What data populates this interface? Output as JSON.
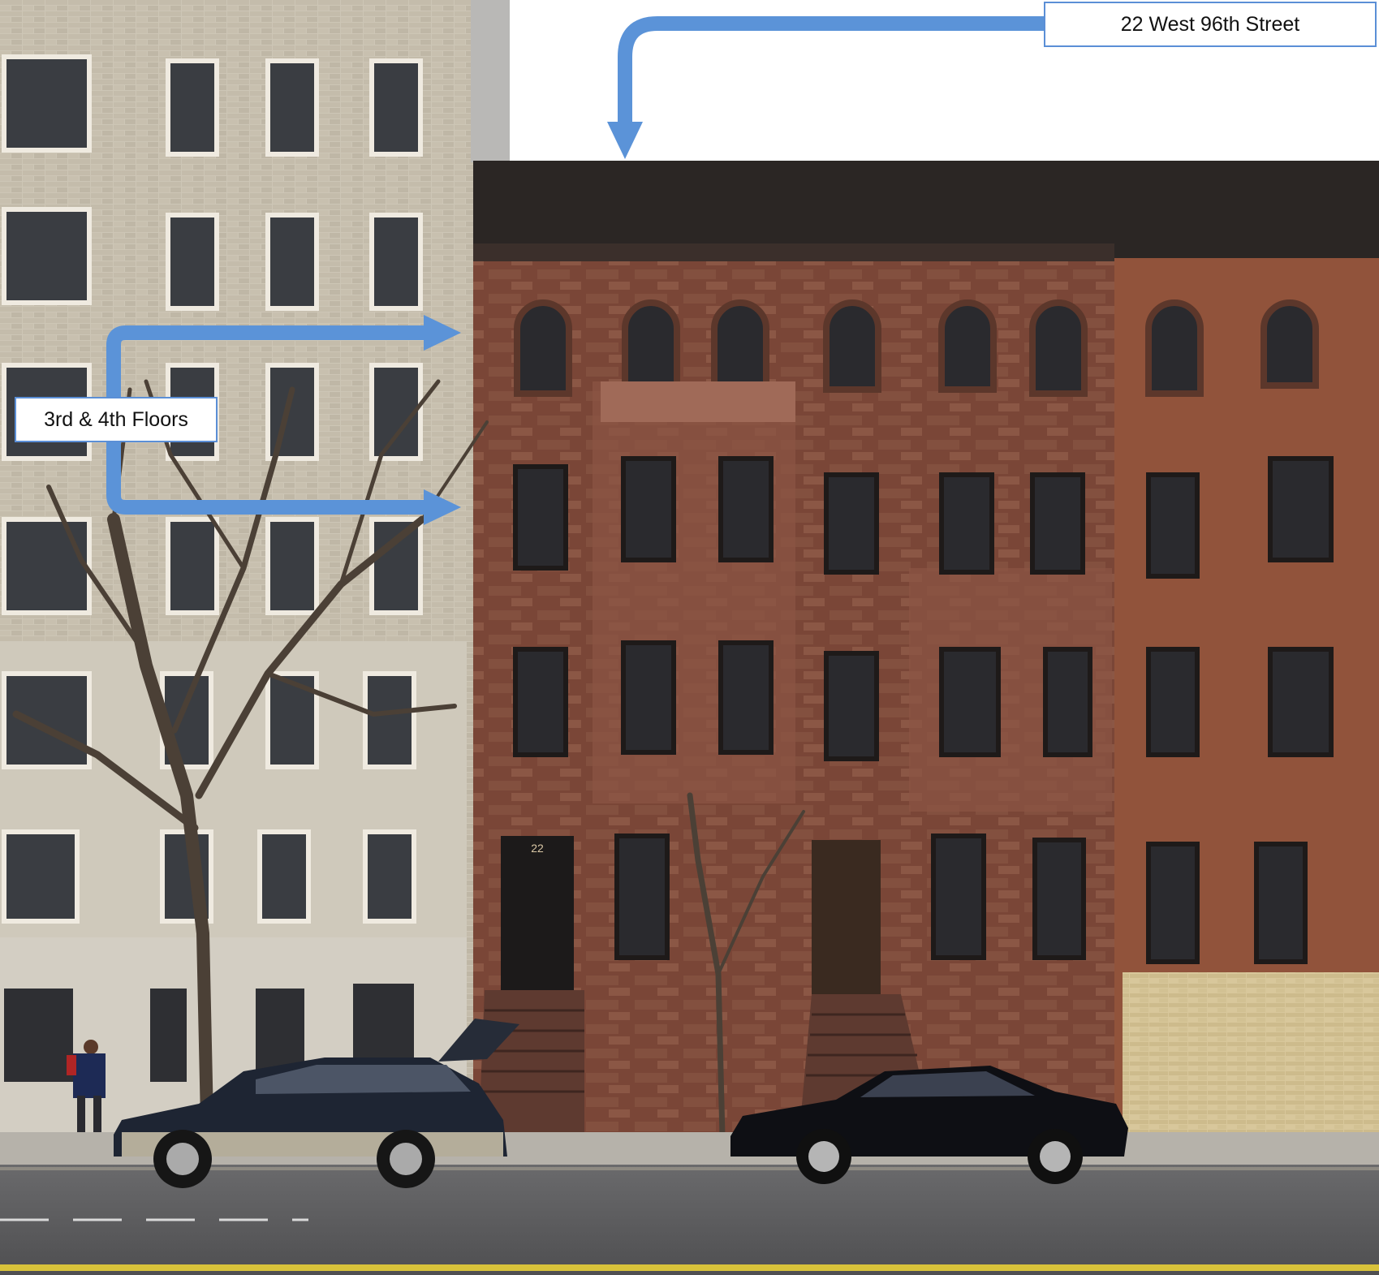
{
  "labels": {
    "address": "22 West 96th Street",
    "floors": "3rd & 4th Floors"
  },
  "colors": {
    "arrow": "#5b93d8",
    "brownstone": "#7d4a3a",
    "brownstone_right": "#93553d",
    "limestone_building": "#c9c2b2",
    "street": "#5d5d5f",
    "sky": "#ffffff"
  },
  "house_number": "22",
  "photo_description": ""
}
